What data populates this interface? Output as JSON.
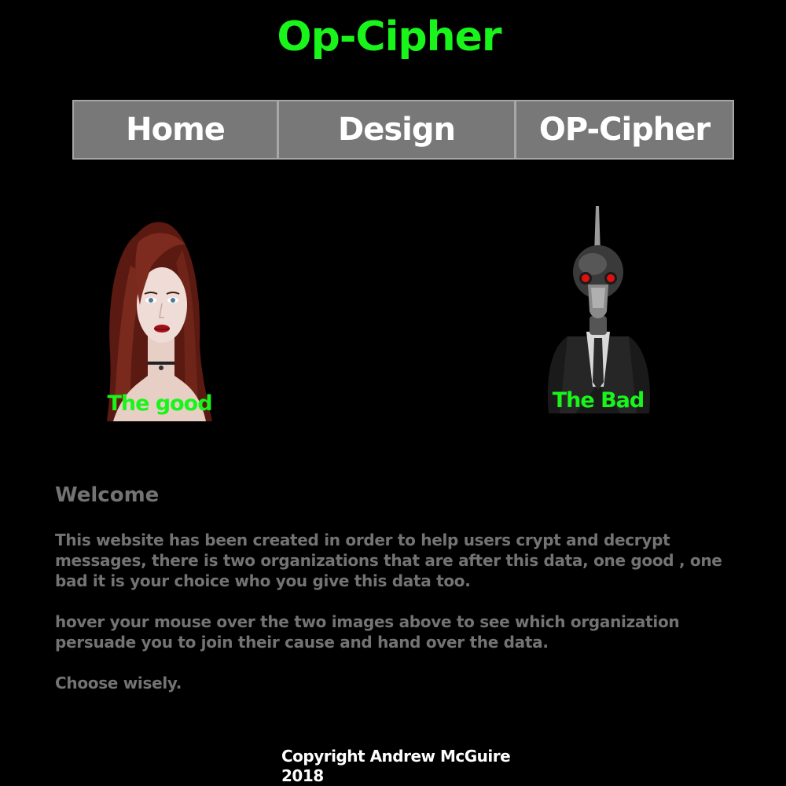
{
  "site": {
    "title": "Op-Cipher",
    "accent_color": "#19f51a"
  },
  "nav": {
    "items": [
      {
        "label": "Home"
      },
      {
        "label": "Design"
      },
      {
        "label": "OP-Cipher"
      }
    ]
  },
  "organizations": {
    "good": {
      "caption": "The good",
      "icon": "red-haired-woman-avatar"
    },
    "bad": {
      "caption": "The Bad",
      "icon": "gas-mask-figure-avatar"
    }
  },
  "welcome": {
    "heading": "Welcome",
    "paragraphs": [
      "This website has been created in order to help users crypt and decrypt messages, there is two organizations that are after this data,  one good , one bad it is your choice who you give this data too.",
      "hover your mouse over the two images above to see which organization persuade you to join their cause and hand over the data.",
      "Choose wisely."
    ]
  },
  "footer": {
    "copyright": "Copyright Andrew McGuire",
    "year": "2018"
  }
}
